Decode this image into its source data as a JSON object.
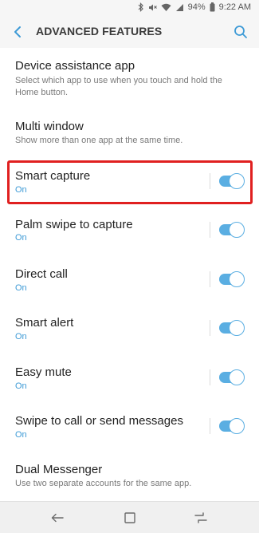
{
  "status": {
    "battery": "94%",
    "time": "9:22 AM"
  },
  "header": {
    "title": "ADVANCED FEATURES"
  },
  "items": [
    {
      "title": "Device assistance app",
      "subtitle": "Select which app to use when you touch and hold the Home button."
    },
    {
      "title": "Multi window",
      "subtitle": "Show more than one app at the same time."
    },
    {
      "title": "Smart capture",
      "subtitle": "On",
      "toggle": true
    },
    {
      "title": "Palm swipe to capture",
      "subtitle": "On",
      "toggle": true
    },
    {
      "title": "Direct call",
      "subtitle": "On",
      "toggle": true
    },
    {
      "title": "Smart alert",
      "subtitle": "On",
      "toggle": true
    },
    {
      "title": "Easy mute",
      "subtitle": "On",
      "toggle": true
    },
    {
      "title": "Swipe to call or send messages",
      "subtitle": "On",
      "toggle": true
    },
    {
      "title": "Dual Messenger",
      "subtitle": "Use two separate accounts for the same app."
    }
  ],
  "icons": {
    "back": "back-arrow-icon",
    "search": "search-icon",
    "nav_back": "nav-back-icon",
    "nav_home": "nav-home-icon",
    "nav_recents": "nav-recents-icon"
  },
  "colors": {
    "accent": "#3d9ad6",
    "toggle_on": "#5aaee2",
    "highlight": "#e02020"
  }
}
